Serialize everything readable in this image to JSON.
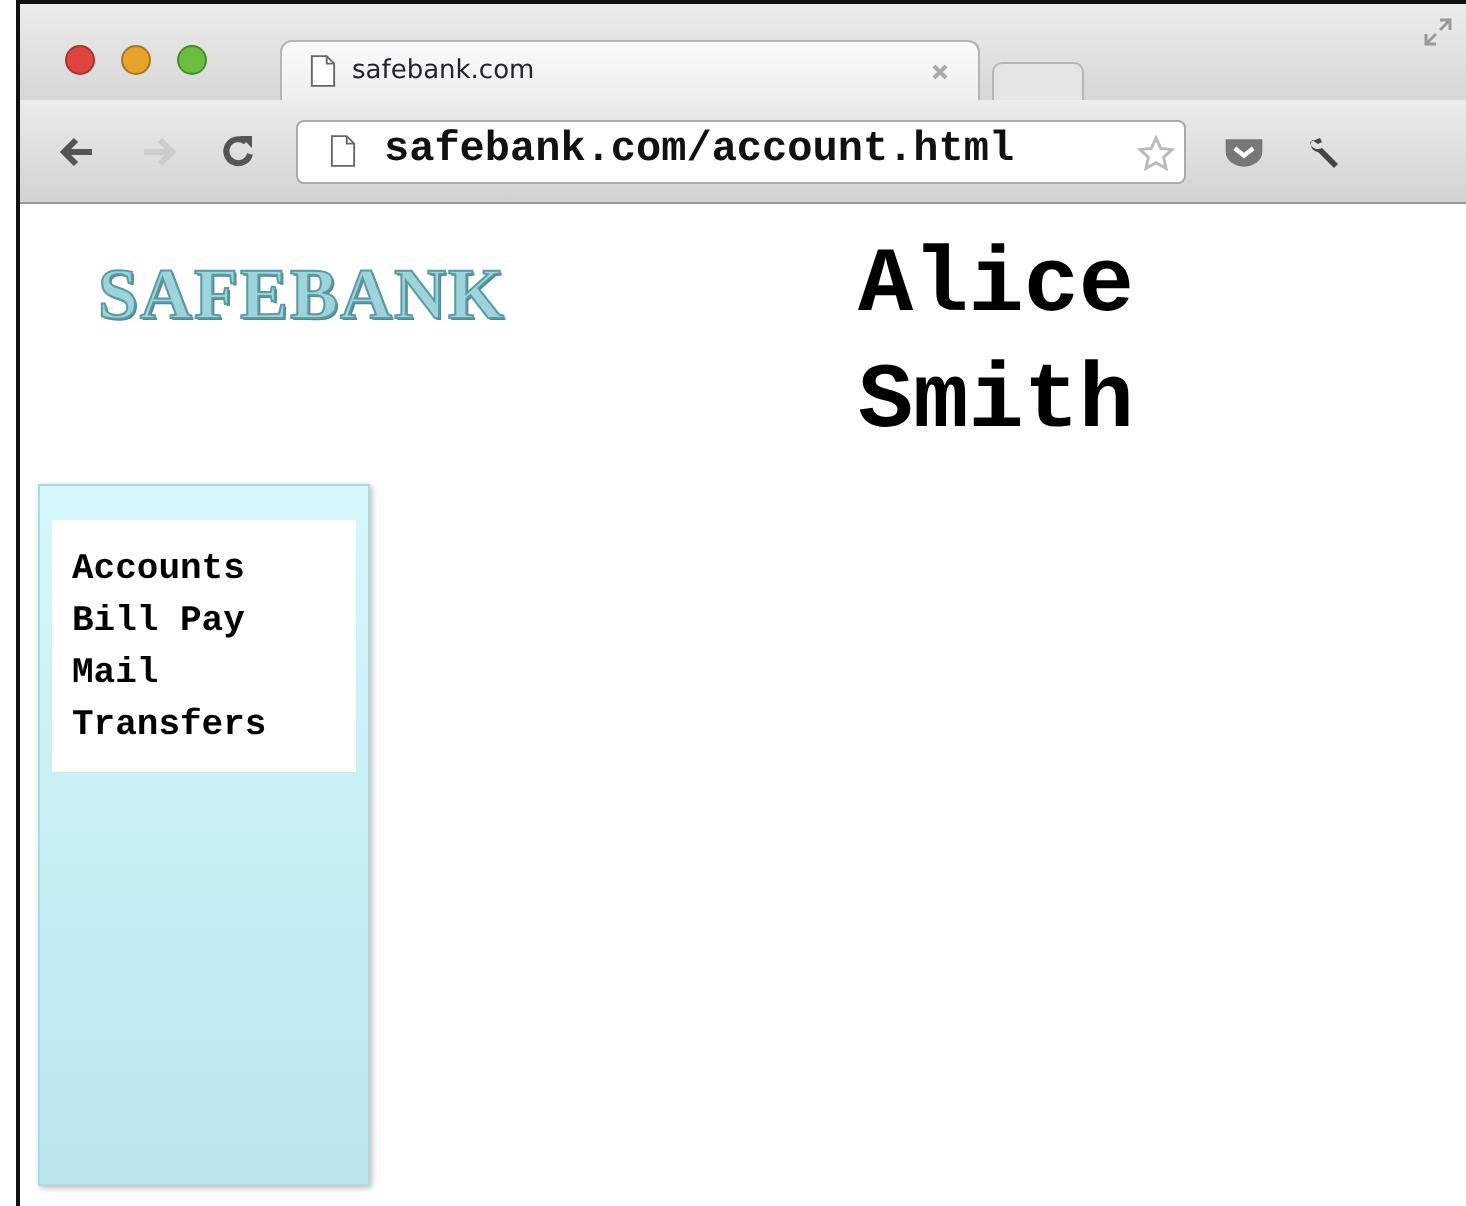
{
  "browser": {
    "tab_title": "safebank.com",
    "url": "safebank.com/account.html"
  },
  "page": {
    "logo": "SAFEBANK",
    "user_name": "Alice Smith",
    "nav": [
      {
        "label": "Accounts"
      },
      {
        "label": "Bill Pay"
      },
      {
        "label": "Mail"
      },
      {
        "label": "Transfers"
      }
    ]
  }
}
